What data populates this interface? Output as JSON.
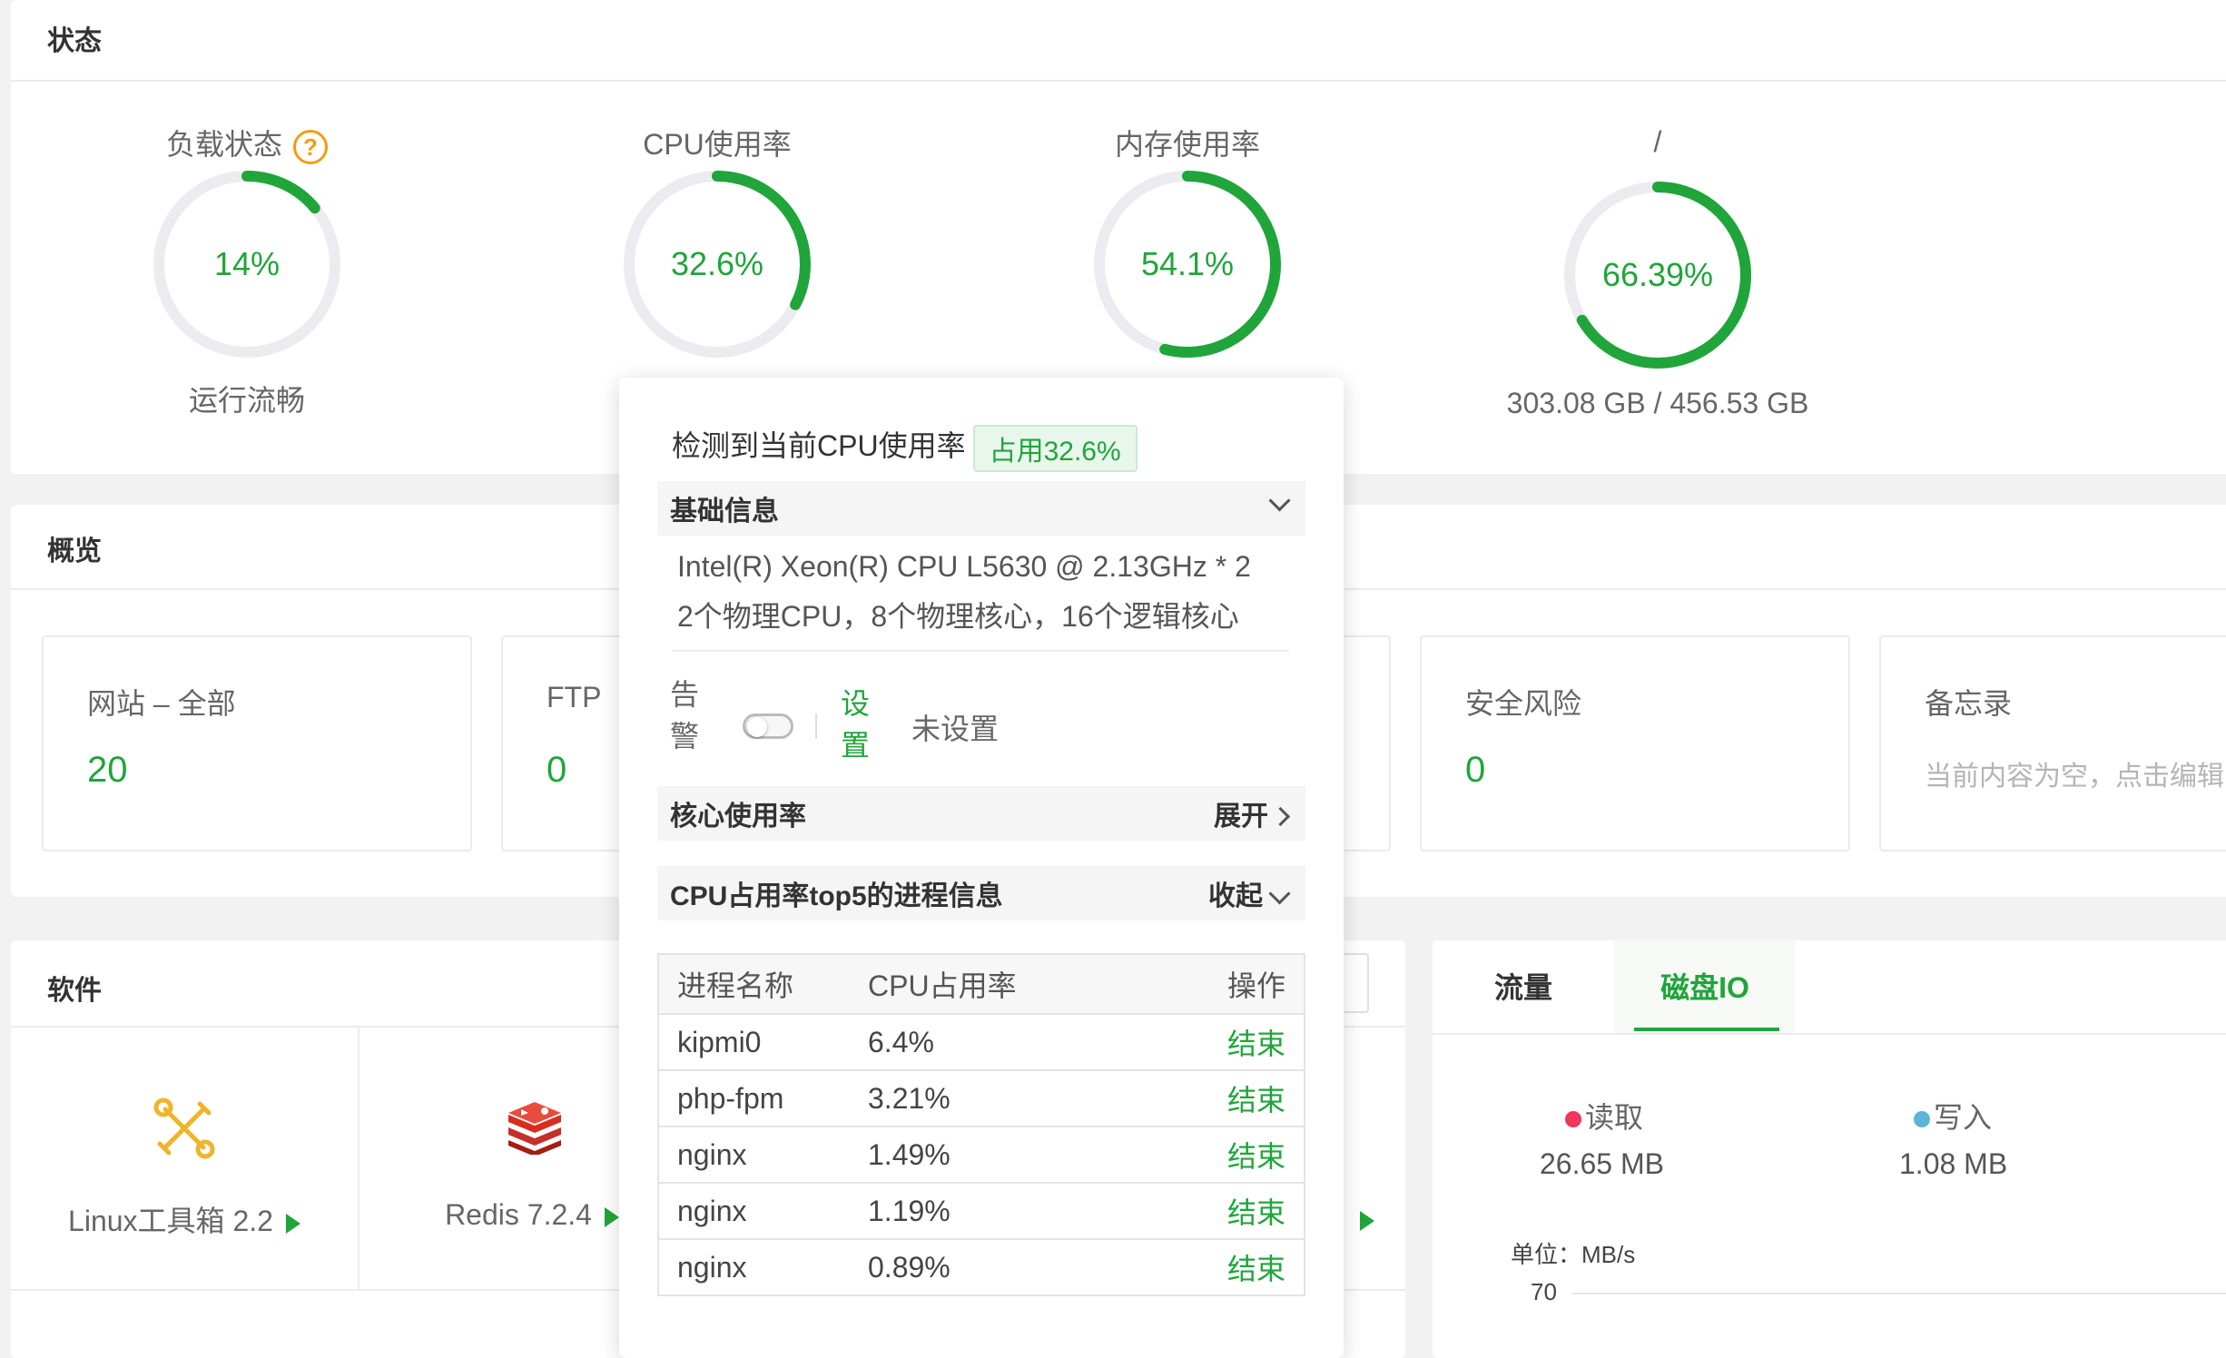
{
  "status": {
    "title": "状态",
    "gauges": [
      {
        "label": "负载状态",
        "value": "14%",
        "percent": 14,
        "sub": "运行流畅",
        "color": "#20a53a"
      },
      {
        "label": "CPU使用率",
        "value": "32.6%",
        "percent": 32.6,
        "sub": "",
        "color": "#20a53a"
      },
      {
        "label": "内存使用率",
        "value": "54.1%",
        "percent": 54.1,
        "sub": "",
        "color": "#20a53a"
      },
      {
        "label": "/",
        "value": "66.39%",
        "percent": 66.39,
        "sub": "303.08 GB / 456.53 GB",
        "color": "#20a53a"
      }
    ]
  },
  "overview": {
    "title": "概览",
    "cards": [
      {
        "label": "网站 – 全部",
        "value": "20"
      },
      {
        "label": "FTP",
        "value": "0"
      },
      {
        "label": "安全风险",
        "value": "0"
      },
      {
        "label": "备忘录",
        "note": "当前内容为空，点击编辑"
      }
    ]
  },
  "software": {
    "title": "软件",
    "items": [
      {
        "name": "Linux工具箱 2.2",
        "icon": "tools-icon"
      },
      {
        "name": "Redis 7.2.4",
        "icon": "redis-icon"
      }
    ]
  },
  "traffic": {
    "tabs": [
      "流量",
      "磁盘IO"
    ],
    "active_tab": "磁盘IO",
    "read": {
      "label": "读取",
      "value": "26.65 MB",
      "color": "#f0365b"
    },
    "write": {
      "label": "写入",
      "value": "1.08 MB",
      "color": "#5bb5d6"
    },
    "unit": "单位：MB/s",
    "y_tick": "70"
  },
  "cpu_popup": {
    "heading": "检测到当前CPU使用率",
    "badge": "占用32.6%",
    "basic_info_title": "基础信息",
    "cpu_model": "Intel(R) Xeon(R) CPU L5630 @ 2.13GHz * 2",
    "cpu_cores": "2个物理CPU，8个物理核心，16个逻辑核心",
    "alarm_label_1": "告",
    "alarm_label_2": "警",
    "alarm_enabled": false,
    "setting_label_1": "设",
    "setting_label_2": "置",
    "alarm_status": "未设置",
    "core_usage_title": "核心使用率",
    "core_usage_action": "展开",
    "top5_title": "CPU占用率top5的进程信息",
    "top5_action": "收起",
    "table": {
      "headers": [
        "进程名称",
        "CPU占用率",
        "操作"
      ],
      "rows": [
        {
          "name": "kipmi0",
          "cpu": "6.4%",
          "action": "结束"
        },
        {
          "name": "php-fpm",
          "cpu": "3.21%",
          "action": "结束"
        },
        {
          "name": "nginx",
          "cpu": "1.49%",
          "action": "结束"
        },
        {
          "name": "nginx",
          "cpu": "1.19%",
          "action": "结束"
        },
        {
          "name": "nginx",
          "cpu": "0.89%",
          "action": "结束"
        }
      ]
    }
  }
}
